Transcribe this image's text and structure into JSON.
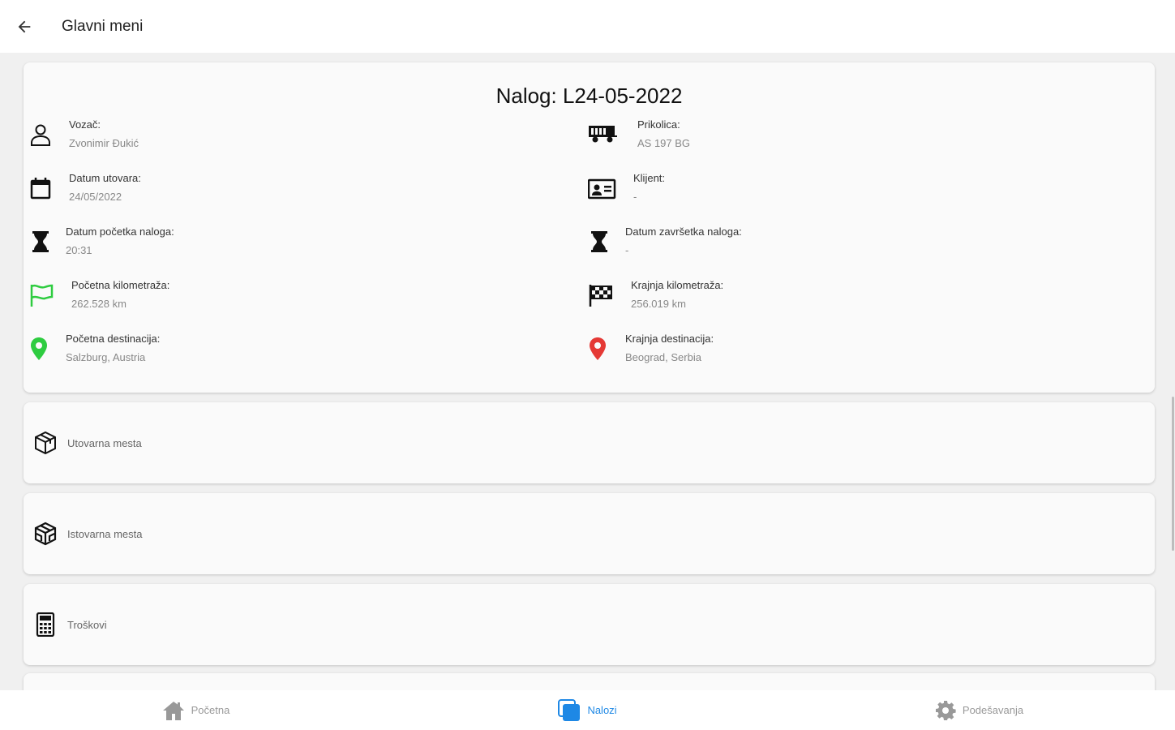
{
  "header": {
    "title": "Glavni meni"
  },
  "order": {
    "title": "Nalog: L24-05-2022",
    "left": [
      {
        "label": "Vozač:",
        "value": "Zvonimir Đukić",
        "icon": "person-icon"
      },
      {
        "label": "Datum utovara:",
        "value": "24/05/2022",
        "icon": "calendar-icon"
      },
      {
        "label": "Datum početka naloga:",
        "value": "20:31",
        "icon": "hourglass-icon"
      },
      {
        "label": "Početna kilometraža:",
        "value": "262.528 km",
        "icon": "flag-icon"
      },
      {
        "label": "Početna destinacija:",
        "value": "Salzburg, Austria",
        "icon": "location-pin-icon"
      }
    ],
    "right": [
      {
        "label": "Prikolica:",
        "value": "AS 197 BG",
        "icon": "trailer-icon"
      },
      {
        "label": "Klijent:",
        "value": "-",
        "icon": "id-card-icon"
      },
      {
        "label": "Datum završetka naloga:",
        "value": "-",
        "icon": "hourglass-icon"
      },
      {
        "label": "Krajnja kilometraža:",
        "value": "256.019 km",
        "icon": "checkered-flag-icon"
      },
      {
        "label": "Krajnja destinacija:",
        "value": "Beograd, Serbia",
        "icon": "location-pin-icon"
      }
    ]
  },
  "menu": [
    {
      "label": "Utovarna mesta",
      "icon": "package-icon"
    },
    {
      "label": "Istovarna mesta",
      "icon": "package-unload-icon"
    },
    {
      "label": "Troškovi",
      "icon": "calculator-icon"
    }
  ],
  "nav": [
    {
      "label": "Početna",
      "icon": "home-icon",
      "active": false
    },
    {
      "label": "Nalozi",
      "icon": "documents-icon",
      "active": true
    },
    {
      "label": "Podešavanja",
      "icon": "gear-icon",
      "active": false
    }
  ],
  "colors": {
    "accent": "#1e88e5",
    "start_green": "#2ecc40",
    "end_red": "#e53935"
  }
}
